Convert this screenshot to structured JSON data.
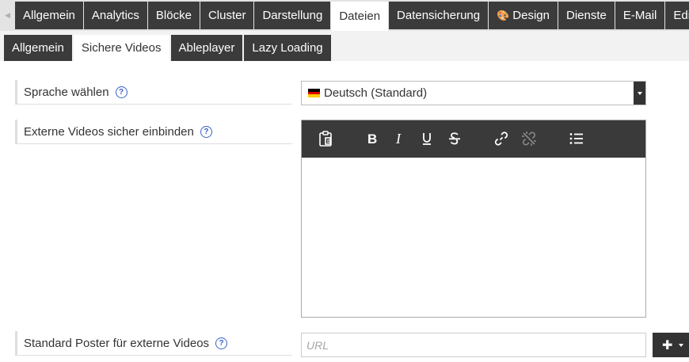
{
  "tabs_main": [
    {
      "label": "Allgemein",
      "active": false
    },
    {
      "label": "Analytics",
      "active": false
    },
    {
      "label": "Blöcke",
      "active": false
    },
    {
      "label": "Cluster",
      "active": false
    },
    {
      "label": "Darstellung",
      "active": false
    },
    {
      "label": "Dateien",
      "active": true
    },
    {
      "label": "Datensicherung",
      "active": false
    },
    {
      "label": "Design",
      "active": false,
      "icon": "palette-icon"
    },
    {
      "label": "Dienste",
      "active": false
    },
    {
      "label": "E-Mail",
      "active": false
    },
    {
      "label": "Editor",
      "active": false
    }
  ],
  "tabs_sub": [
    {
      "label": "Allgemein",
      "active": false
    },
    {
      "label": "Sichere Videos",
      "active": true
    },
    {
      "label": "Ableplayer",
      "active": false
    },
    {
      "label": "Lazy Loading",
      "active": false
    }
  ],
  "form": {
    "language_label": "Sprache wählen",
    "language_value": "Deutsch (Standard)",
    "embed_label": "Externe Videos sicher einbinden",
    "poster_label": "Standard Poster für externe Videos",
    "poster_placeholder": "URL",
    "help_glyph": "?"
  },
  "colors": {
    "tab_dark": "#3b3b3b",
    "toolbar": "#3a3a3a",
    "help_blue": "#3a62c7"
  }
}
